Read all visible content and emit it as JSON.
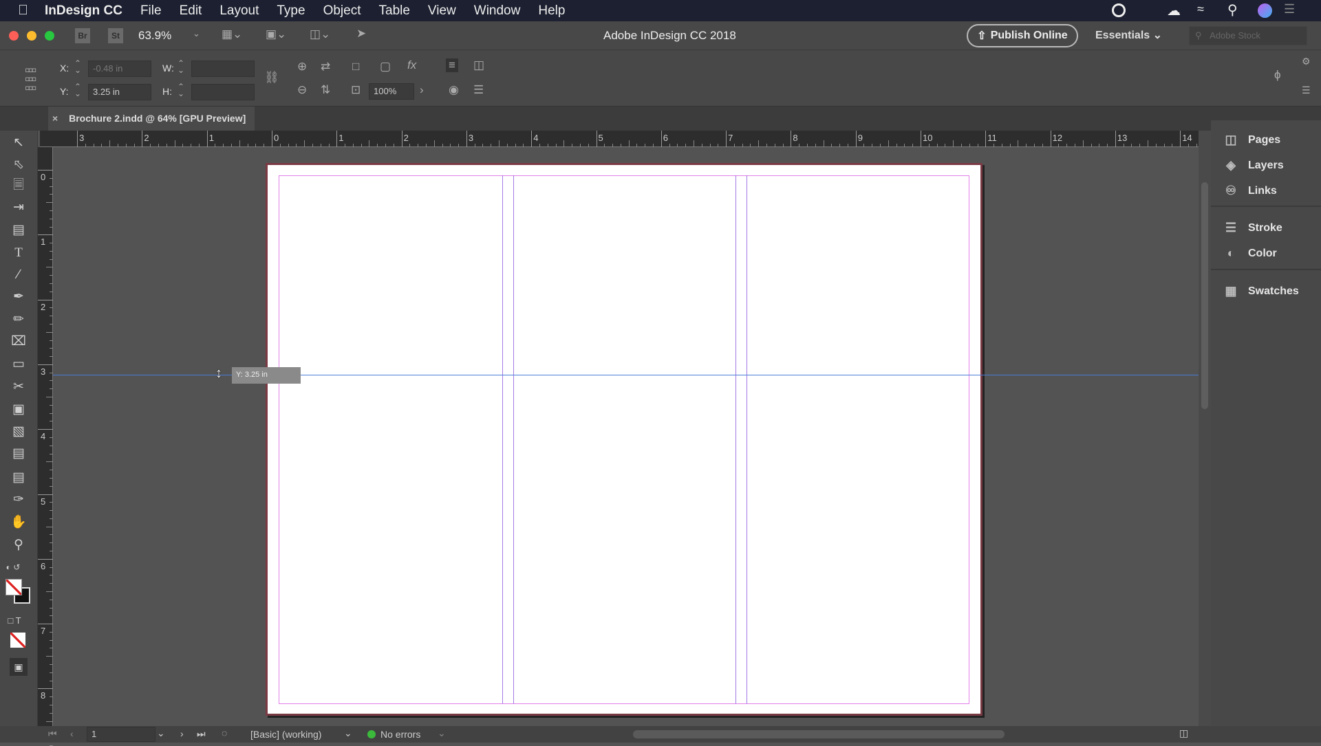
{
  "menubar": {
    "app": "InDesign CC",
    "items": [
      "File",
      "Edit",
      "Layout",
      "Type",
      "Object",
      "Table",
      "View",
      "Window",
      "Help"
    ]
  },
  "appbar": {
    "bridge": "Br",
    "stock": "St",
    "zoom": "63.9%",
    "title": "Adobe InDesign CC 2018",
    "publish": "Publish Online",
    "workspace": "Essentials",
    "search_placeholder": "Adobe Stock"
  },
  "control": {
    "x_label": "X:",
    "x_value": "-0.48 in",
    "y_label": "Y:",
    "y_value": "3.25 in",
    "w_label": "W:",
    "h_label": "H:",
    "scale": "100%"
  },
  "tab": {
    "title": "Brochure 2.indd @ 64% [GPU Preview]"
  },
  "rulers": {
    "h": [
      "3",
      "2",
      "1",
      "0",
      "1",
      "2",
      "3",
      "4",
      "5",
      "6",
      "7",
      "8",
      "9",
      "10",
      "11",
      "12",
      "13",
      "14"
    ],
    "v": [
      "0",
      "1",
      "2",
      "3",
      "4",
      "5",
      "6",
      "7",
      "8"
    ]
  },
  "guide": {
    "tooltip": "Y: 3.25 in"
  },
  "panels": {
    "items": [
      "Pages",
      "Layers",
      "Links",
      "Stroke",
      "Color",
      "Swatches"
    ]
  },
  "status": {
    "page": "1",
    "preflight_profile": "[Basic] (working)",
    "errors": "No errors"
  },
  "colors": {
    "guide": "#4a7bd8",
    "margin": "#e27fe8",
    "column": "#a37ae6",
    "bleed": "#d5303f"
  }
}
